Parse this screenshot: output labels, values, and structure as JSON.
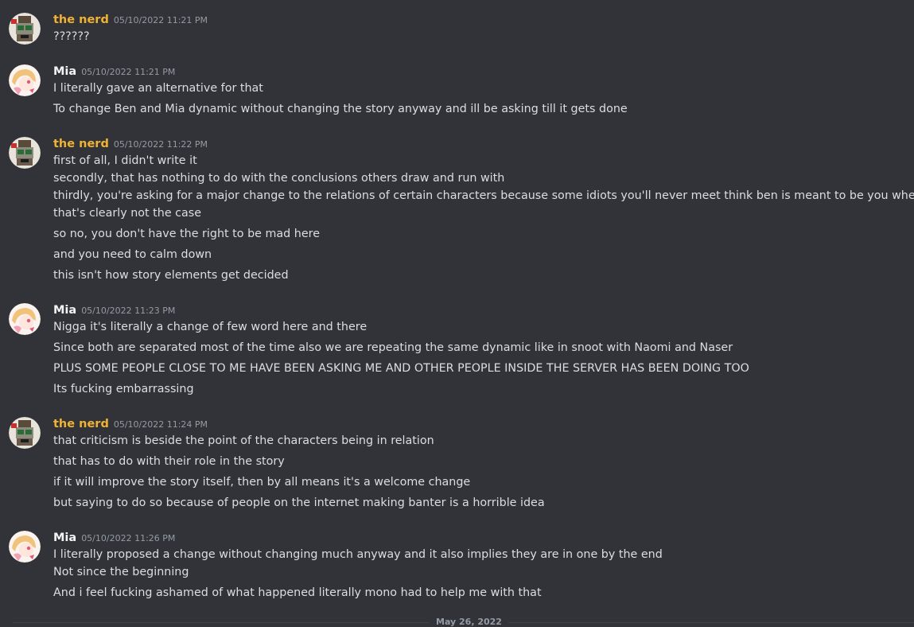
{
  "colors": {
    "background": "#313338",
    "text": "#dbdee1",
    "muted": "#949ba4",
    "nerd_name": "#f0b232",
    "mia_name": "#f2f3f5"
  },
  "messages": [
    {
      "author": "the nerd",
      "timestamp": "05/10/2022 11:21 PM",
      "avatar_icon": "nerd-avatar",
      "lines": [
        "??????"
      ]
    },
    {
      "author": "Mia",
      "timestamp": "05/10/2022 11:21 PM",
      "avatar_icon": "mia-avatar",
      "lines": [
        "I literally gave an alternative for that",
        "To change Ben and Mia dynamic without changing the story anyway and ill be asking till it gets done"
      ]
    },
    {
      "author": "the nerd",
      "timestamp": "05/10/2022 11:22 PM",
      "avatar_icon": "nerd-avatar",
      "lines": [
        "first of all, I didn't write it",
        "secondly, that has nothing to do with the conclusions others draw and run with",
        "thirdly, you're asking for a major change to the relations of certain characters because some idiots you'll never meet think ben is meant to be you when",
        "that's clearly not the case",
        "so no, you don't have the right to be mad here",
        "and you need to calm down",
        "this isn't how story elements get decided"
      ]
    },
    {
      "author": "Mia",
      "timestamp": "05/10/2022 11:23 PM",
      "avatar_icon": "mia-avatar",
      "lines": [
        "Nigga it's literally a change of few word here and there",
        "Since both are separated most of the time also we are repeating the same dynamic like in snoot with Naomi and Naser",
        "PLUS SOME PEOPLE CLOSE TO ME HAVE BEEN ASKING ME AND OTHER PEOPLE INSIDE THE SERVER HAS BEEN DOING TOO",
        "Its fucking embarrassing"
      ]
    },
    {
      "author": "the nerd",
      "timestamp": "05/10/2022 11:24 PM",
      "avatar_icon": "nerd-avatar",
      "lines": [
        "that criticism is beside the point of the characters being in relation",
        "that has to do with their role in the story",
        "if it will improve the story itself, then by all means it's a welcome change",
        "but saying to do so because of people on the internet making banter is a horrible idea"
      ]
    },
    {
      "author": "Mia",
      "timestamp": "05/10/2022 11:26 PM",
      "avatar_icon": "mia-avatar",
      "lines": [
        "I literally proposed a change without changing much anyway and it also implies they are in one by the end",
        "Not since the beginning",
        "And i feel fucking ashamed of what happened literally mono had to help me with that"
      ]
    }
  ],
  "date_divider": "May 26, 2022"
}
